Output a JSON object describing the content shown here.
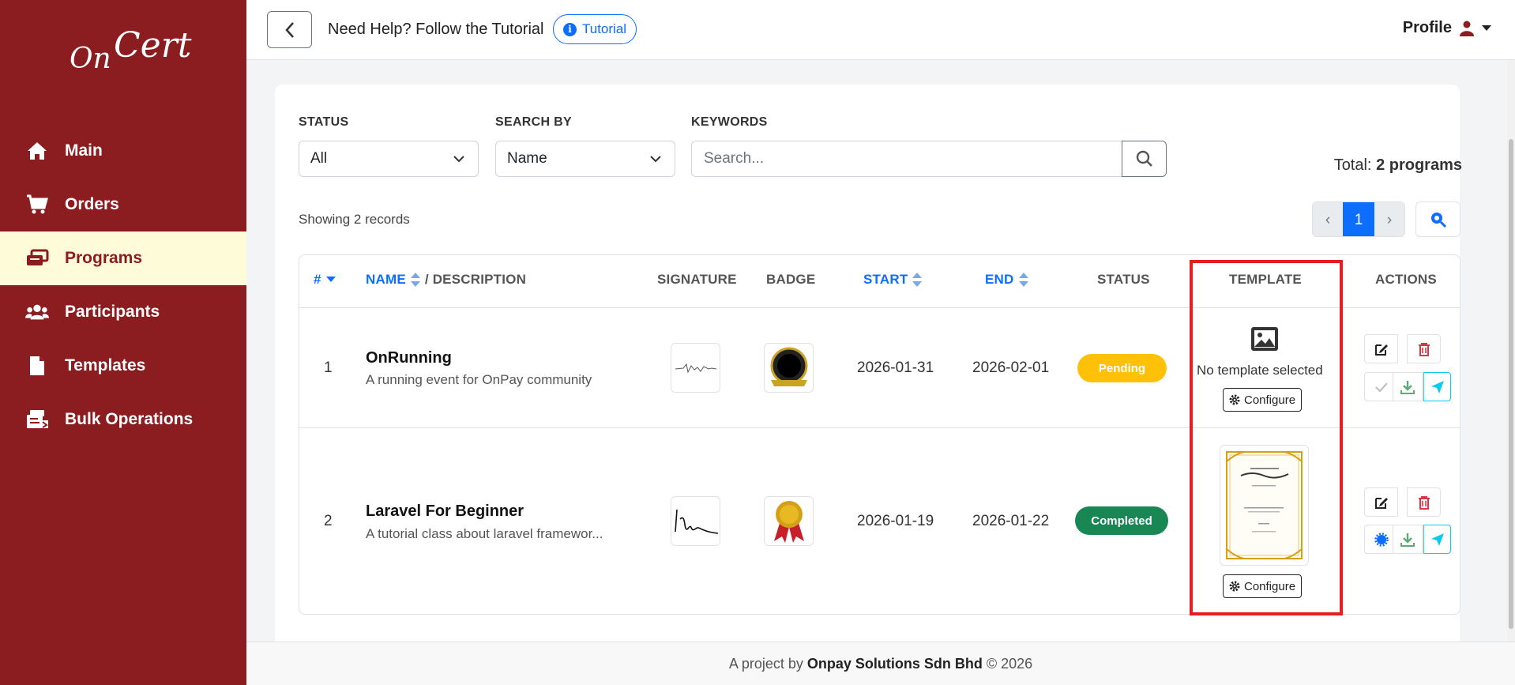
{
  "brand": {
    "logo_text_on": "On",
    "logo_text_cert": "Cert"
  },
  "sidebar": {
    "items": [
      {
        "label": "Main",
        "icon": "home-icon",
        "active": false
      },
      {
        "label": "Orders",
        "icon": "cart-icon",
        "active": false
      },
      {
        "label": "Programs",
        "icon": "programs-icon",
        "active": true
      },
      {
        "label": "Participants",
        "icon": "users-icon",
        "active": false
      },
      {
        "label": "Templates",
        "icon": "file-icon",
        "active": false
      },
      {
        "label": "Bulk Operations",
        "icon": "bulk-icon",
        "active": false
      }
    ]
  },
  "topbar": {
    "help_text": "Need Help? Follow the Tutorial",
    "tutorial_label": "Tutorial",
    "profile_label": "Profile"
  },
  "filters": {
    "status_label": "STATUS",
    "status_value": "All",
    "search_by_label": "SEARCH BY",
    "search_by_value": "Name",
    "keywords_label": "KEYWORDS",
    "keywords_placeholder": "Search..."
  },
  "summary": {
    "total_prefix": "Total:",
    "total_value": "2 programs",
    "showing": "Showing 2 records"
  },
  "pagination": {
    "prev": "‹",
    "current": "1",
    "next": "›"
  },
  "table": {
    "headers": {
      "index": "#",
      "name": "NAME",
      "description": "/ DESCRIPTION",
      "signature": "SIGNATURE",
      "badge": "BADGE",
      "start": "START",
      "end": "END",
      "status": "STATUS",
      "template": "TEMPLATE",
      "actions": "ACTIONS"
    },
    "rows": [
      {
        "index": "1",
        "name": "OnRunning",
        "description": "A running event for OnPay community",
        "start": "2026-01-31",
        "end": "2026-02-01",
        "status": "Pending",
        "template_text": "No template selected",
        "configure": "Configure"
      },
      {
        "index": "2",
        "name": "Laravel For Beginner",
        "description": "A tutorial class about laravel framewor...",
        "start": "2026-01-19",
        "end": "2026-01-22",
        "status": "Completed",
        "configure": "Configure"
      }
    ]
  },
  "footer": {
    "prefix": "A project by",
    "company": "Onpay Solutions Sdn Bhd",
    "suffix": "© 2026"
  },
  "colors": {
    "sidebar": "#8b1c1f",
    "active_bg": "#fefbd8",
    "primary": "#0d6efd",
    "pending": "#ffc107",
    "completed": "#198754",
    "highlight": "#e31e24"
  }
}
